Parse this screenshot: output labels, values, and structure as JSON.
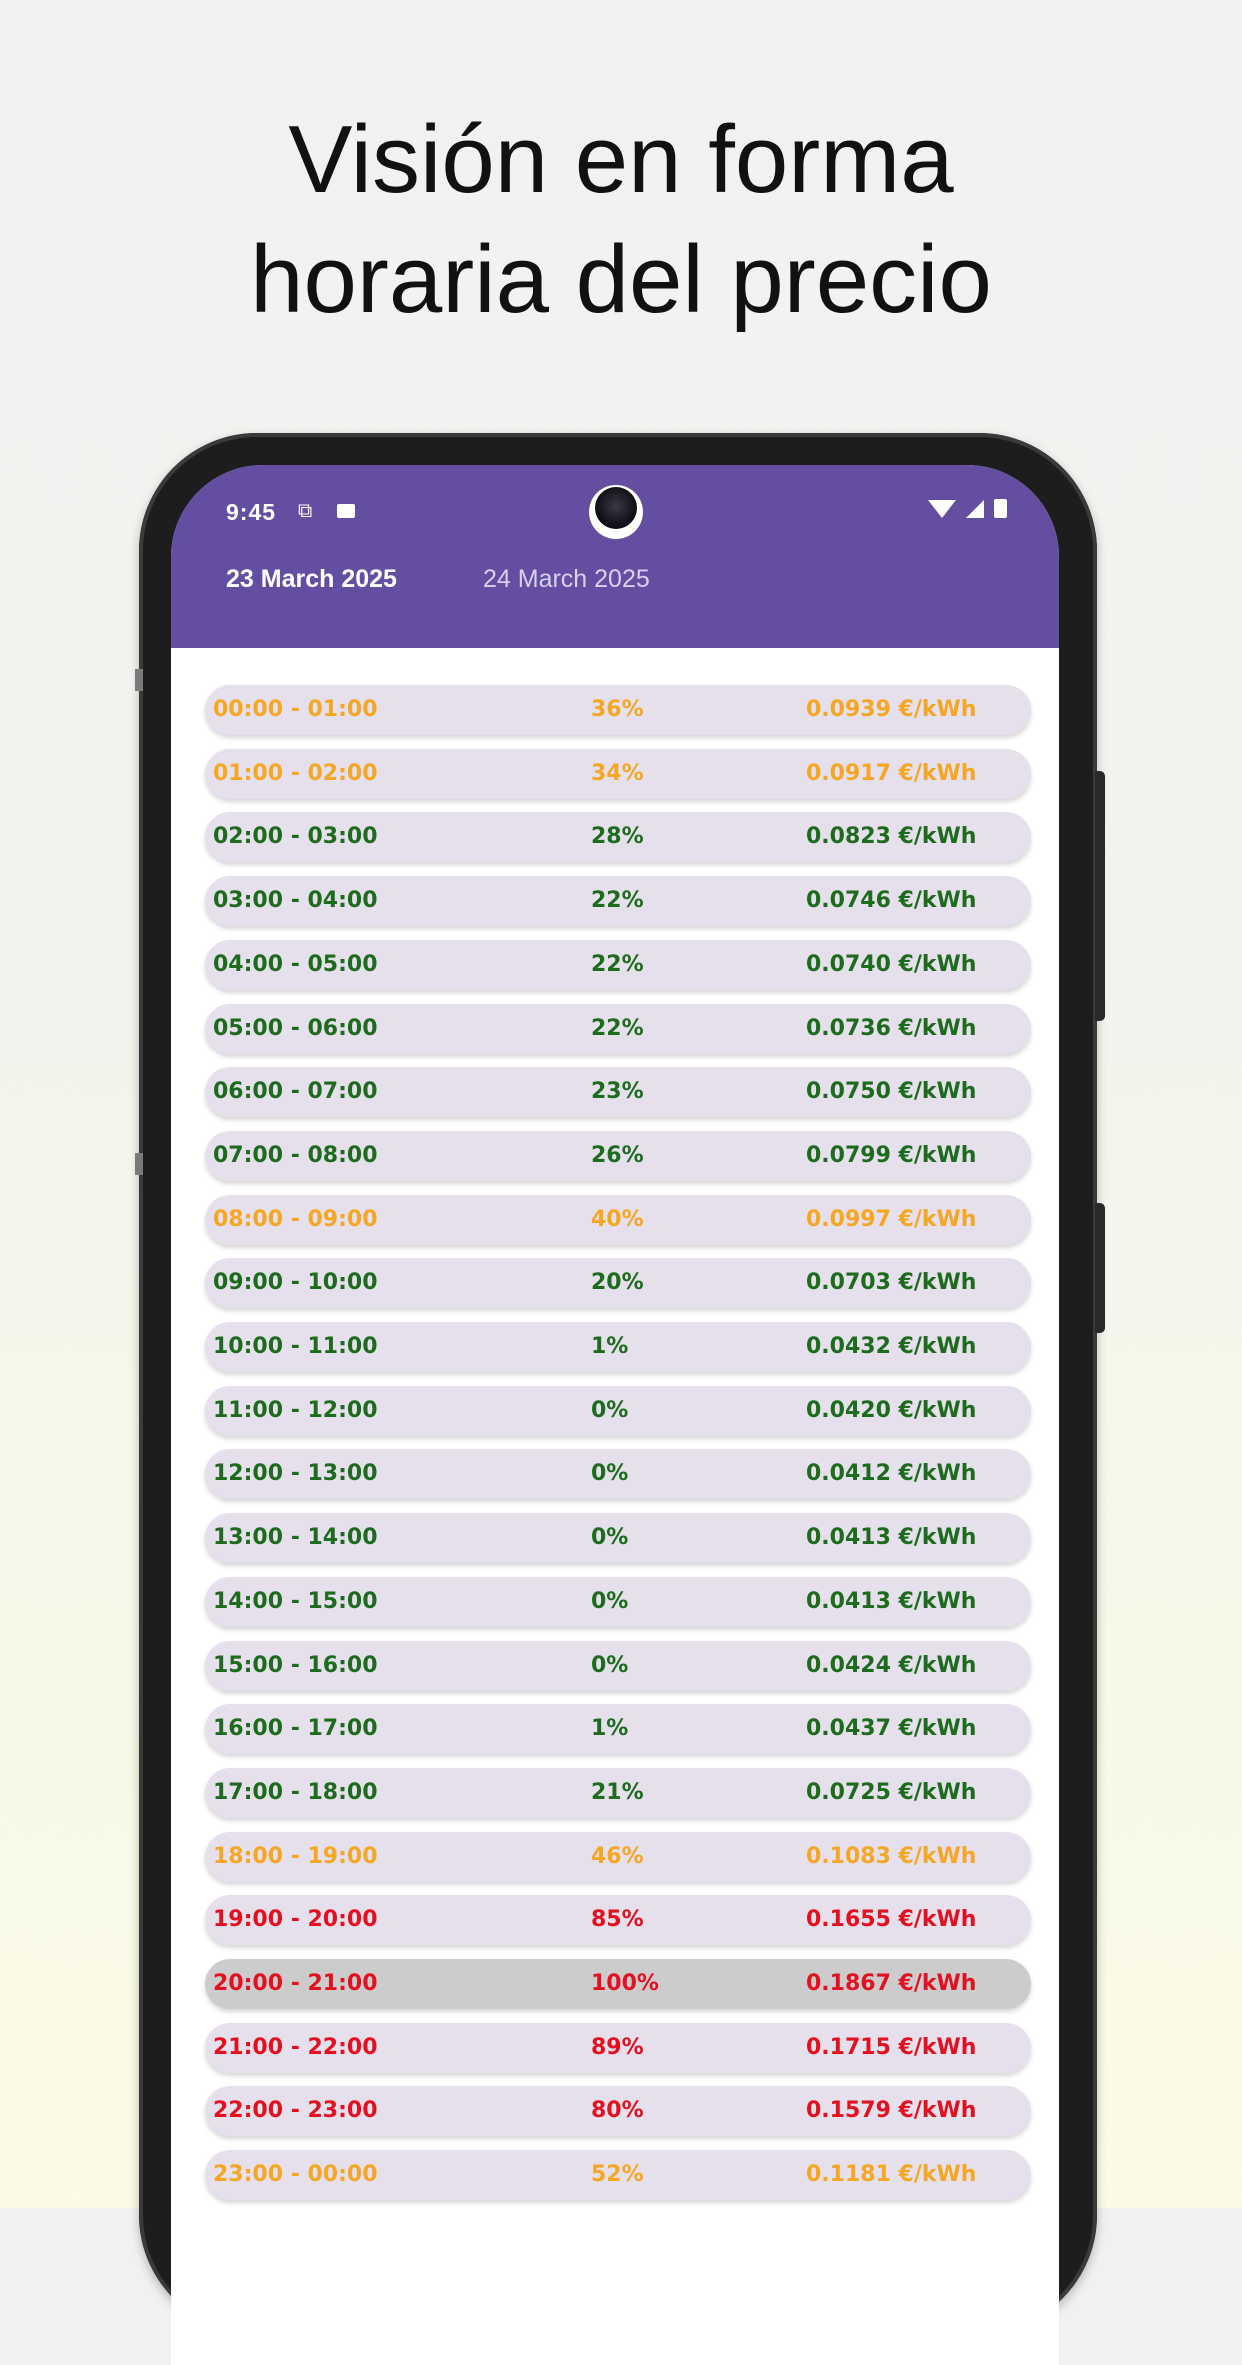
{
  "headline": {
    "line1": "Visión en forma",
    "line2": "horaria del precio"
  },
  "status_bar": {
    "time": "9:45",
    "icons": [
      "copy-icon",
      "photo-icon",
      "wifi-icon",
      "signal-icon",
      "battery-icon"
    ]
  },
  "tabs": [
    {
      "label": "23 March 2025",
      "selected": true
    },
    {
      "label": "24 March 2025",
      "selected": false
    }
  ],
  "colors": {
    "app_bar": "#644ea2",
    "row_bg": "#e6e0ec",
    "row_highlight": "#cccccc",
    "green": "#1d6b1d",
    "orange": "#f5a623",
    "red": "#e3101f"
  },
  "rows": [
    {
      "time": "00:00 - 01:00",
      "percent": "36%",
      "price": "0.0939 €/kWh",
      "level": "orange"
    },
    {
      "time": "01:00 - 02:00",
      "percent": "34%",
      "price": "0.0917 €/kWh",
      "level": "orange"
    },
    {
      "time": "02:00 - 03:00",
      "percent": "28%",
      "price": "0.0823 €/kWh",
      "level": "green"
    },
    {
      "time": "03:00 - 04:00",
      "percent": "22%",
      "price": "0.0746 €/kWh",
      "level": "green"
    },
    {
      "time": "04:00 - 05:00",
      "percent": "22%",
      "price": "0.0740 €/kWh",
      "level": "green"
    },
    {
      "time": "05:00 - 06:00",
      "percent": "22%",
      "price": "0.0736 €/kWh",
      "level": "green"
    },
    {
      "time": "06:00 - 07:00",
      "percent": "23%",
      "price": "0.0750 €/kWh",
      "level": "green"
    },
    {
      "time": "07:00 - 08:00",
      "percent": "26%",
      "price": "0.0799 €/kWh",
      "level": "green"
    },
    {
      "time": "08:00 - 09:00",
      "percent": "40%",
      "price": "0.0997 €/kWh",
      "level": "orange"
    },
    {
      "time": "09:00 - 10:00",
      "percent": "20%",
      "price": "0.0703 €/kWh",
      "level": "green"
    },
    {
      "time": "10:00 - 11:00",
      "percent": "1%",
      "price": "0.0432 €/kWh",
      "level": "green"
    },
    {
      "time": "11:00 - 12:00",
      "percent": "0%",
      "price": "0.0420 €/kWh",
      "level": "green"
    },
    {
      "time": "12:00 - 13:00",
      "percent": "0%",
      "price": "0.0412 €/kWh",
      "level": "green"
    },
    {
      "time": "13:00 - 14:00",
      "percent": "0%",
      "price": "0.0413 €/kWh",
      "level": "green"
    },
    {
      "time": "14:00 - 15:00",
      "percent": "0%",
      "price": "0.0413 €/kWh",
      "level": "green"
    },
    {
      "time": "15:00 - 16:00",
      "percent": "0%",
      "price": "0.0424 €/kWh",
      "level": "green"
    },
    {
      "time": "16:00 - 17:00",
      "percent": "1%",
      "price": "0.0437 €/kWh",
      "level": "green"
    },
    {
      "time": "17:00 - 18:00",
      "percent": "21%",
      "price": "0.0725 €/kWh",
      "level": "green"
    },
    {
      "time": "18:00 - 19:00",
      "percent": "46%",
      "price": "0.1083 €/kWh",
      "level": "orange"
    },
    {
      "time": "19:00 - 20:00",
      "percent": "85%",
      "price": "0.1655 €/kWh",
      "level": "red"
    },
    {
      "time": "20:00 - 21:00",
      "percent": "100%",
      "price": "0.1867 €/kWh",
      "level": "red",
      "current": true
    },
    {
      "time": "21:00 - 22:00",
      "percent": "89%",
      "price": "0.1715 €/kWh",
      "level": "red"
    },
    {
      "time": "22:00 - 23:00",
      "percent": "80%",
      "price": "0.1579 €/kWh",
      "level": "red"
    },
    {
      "time": "23:00 - 00:00",
      "percent": "52%",
      "price": "0.1181 €/kWh",
      "level": "orange"
    }
  ]
}
